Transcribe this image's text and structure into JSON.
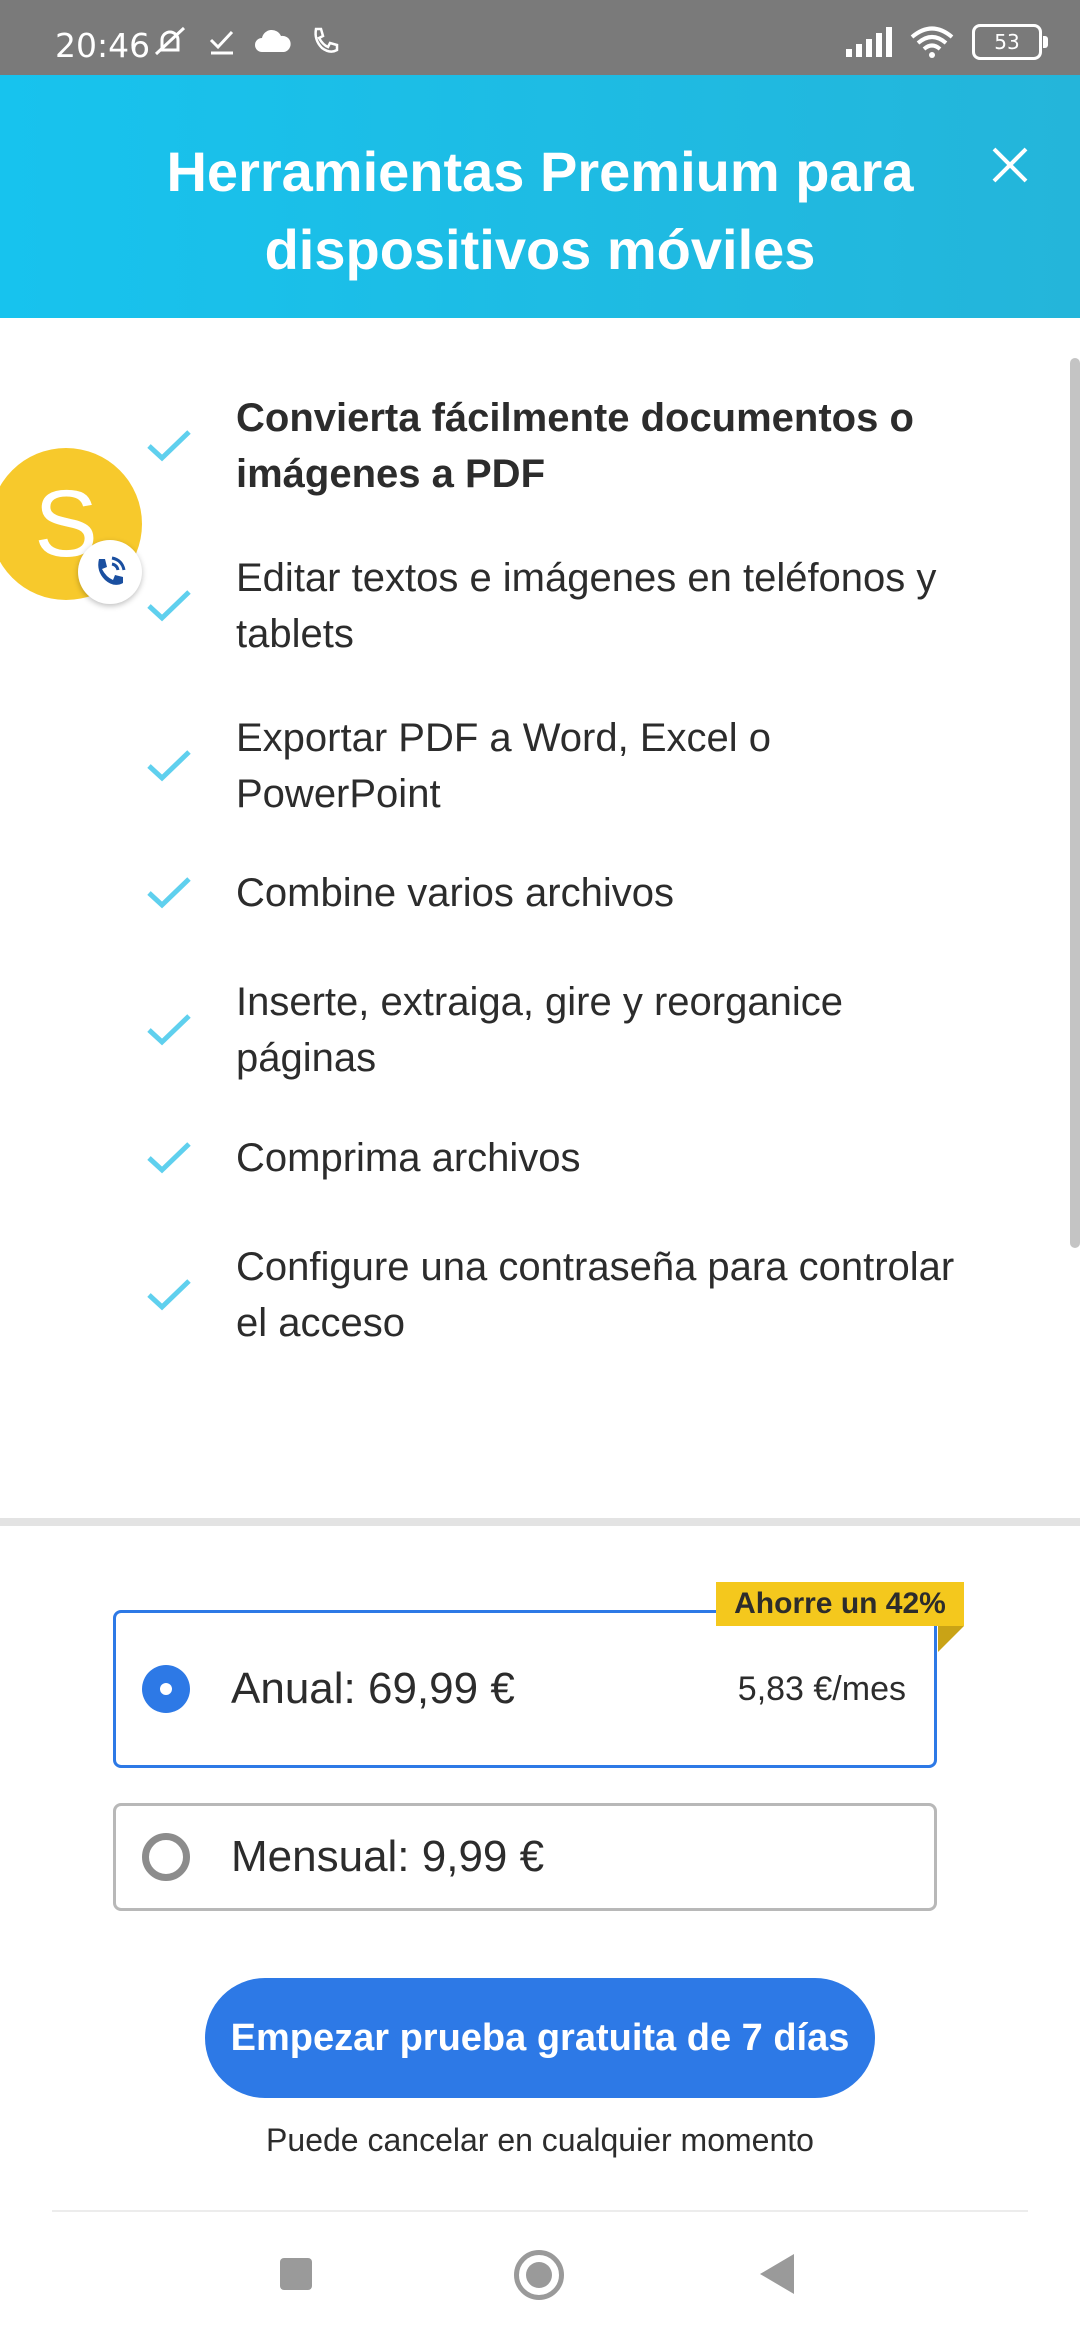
{
  "status_bar": {
    "time": "20:46",
    "battery": "53"
  },
  "header": {
    "title": "Herramientas Premium para dispositivos móviles",
    "close_icon": "close-icon"
  },
  "avatar": {
    "letter": "S"
  },
  "features": [
    "Convierta fácilmente documentos o imágenes a PDF",
    "Editar textos e imágenes en teléfonos y tablets",
    "Exportar PDF a Word, Excel o PowerPoint",
    "Combine varios archivos",
    "Inserte, extraiga, gire y reorganice páginas",
    "Comprima archivos",
    "Configure una contraseña para controlar el acceso"
  ],
  "plans": {
    "badge": "Ahorre un 42%",
    "annual": {
      "label": "Anual: 69,99 €",
      "sub": "5,83 €/mes",
      "selected": true
    },
    "monthly": {
      "label": "Mensual: 9,99 €",
      "selected": false
    }
  },
  "cta": {
    "label": "Empezar prueba gratuita de 7 días",
    "note": "Puede cancelar en cualquier momento"
  },
  "colors": {
    "header": "#17c3ee",
    "accent": "#2d79e6",
    "check": "#5fd0ee",
    "badge": "#f4c81d"
  }
}
